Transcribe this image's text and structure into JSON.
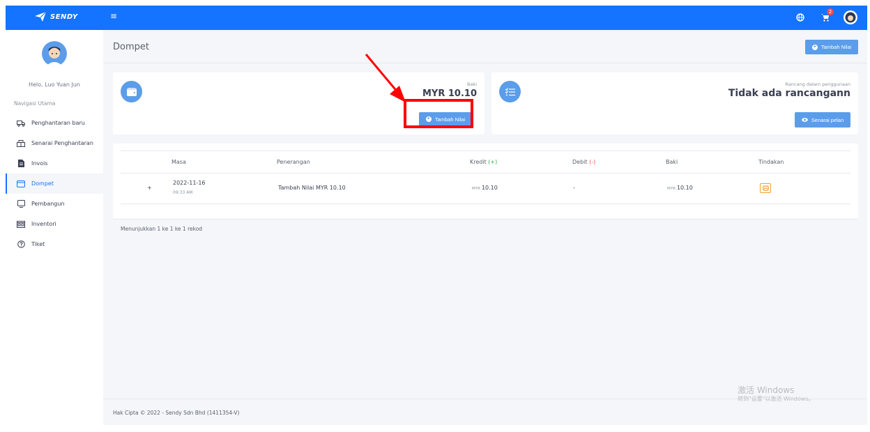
{
  "app": {
    "brand": "SENDY"
  },
  "topbar": {
    "cart_count": "2"
  },
  "sidebar": {
    "greeting": "Helo, Luo Yuan Jun",
    "nav_title": "Navigasi Utama",
    "items": [
      {
        "label": "Penghantaran baru",
        "icon": "truck-icon"
      },
      {
        "label": "Senarai Penghantaran",
        "icon": "list-truck-icon"
      },
      {
        "label": "Invois",
        "icon": "invoice-icon"
      },
      {
        "label": "Dompet",
        "icon": "wallet-icon",
        "active": true
      },
      {
        "label": "Pembangun",
        "icon": "monitor-icon"
      },
      {
        "label": "Inventori",
        "icon": "warehouse-icon"
      },
      {
        "label": "Tiket",
        "icon": "help-icon"
      }
    ]
  },
  "page": {
    "title": "Dompet",
    "header_button": "Tambah Nilai"
  },
  "wallet": {
    "balance_label": "Baki",
    "balance_value": "MYR 10.10",
    "topup_button": "Tambah Nilai"
  },
  "plan": {
    "label": "Rancang dalam penggunaan",
    "value": "Tidak ada rancangann",
    "button": "Senarai pelan"
  },
  "table": {
    "headers": [
      "Masa",
      "Penerangan",
      "Kredit",
      "Debit",
      "Baki",
      "Tindakan"
    ],
    "credit_sign": "(+)",
    "debit_sign": "(-)",
    "rows": [
      {
        "expand": "+",
        "date": "2022-11-16",
        "time": "09:33 AM",
        "description": "Tambah Nilai MYR 10.10",
        "credit_currency": "MYR",
        "credit": "10.10",
        "debit": "-",
        "balance_currency": "MYR",
        "balance": "10.10"
      }
    ],
    "footer": "Menunjukkan 1 ke 1 ke 1 rekod"
  },
  "footer": {
    "copyright": "Hak Cipta © 2022 - Sendy Sdn Bhd (1411354-V)"
  },
  "watermark": {
    "line1": "激活 Windows",
    "line2": "转到\"设置\"以激活 Windows。"
  },
  "colors": {
    "primary": "#1473ff",
    "button": "#5b9dea",
    "highlight": "#ff0000",
    "credit": "#2eaa50",
    "debit": "#f04c4c"
  }
}
